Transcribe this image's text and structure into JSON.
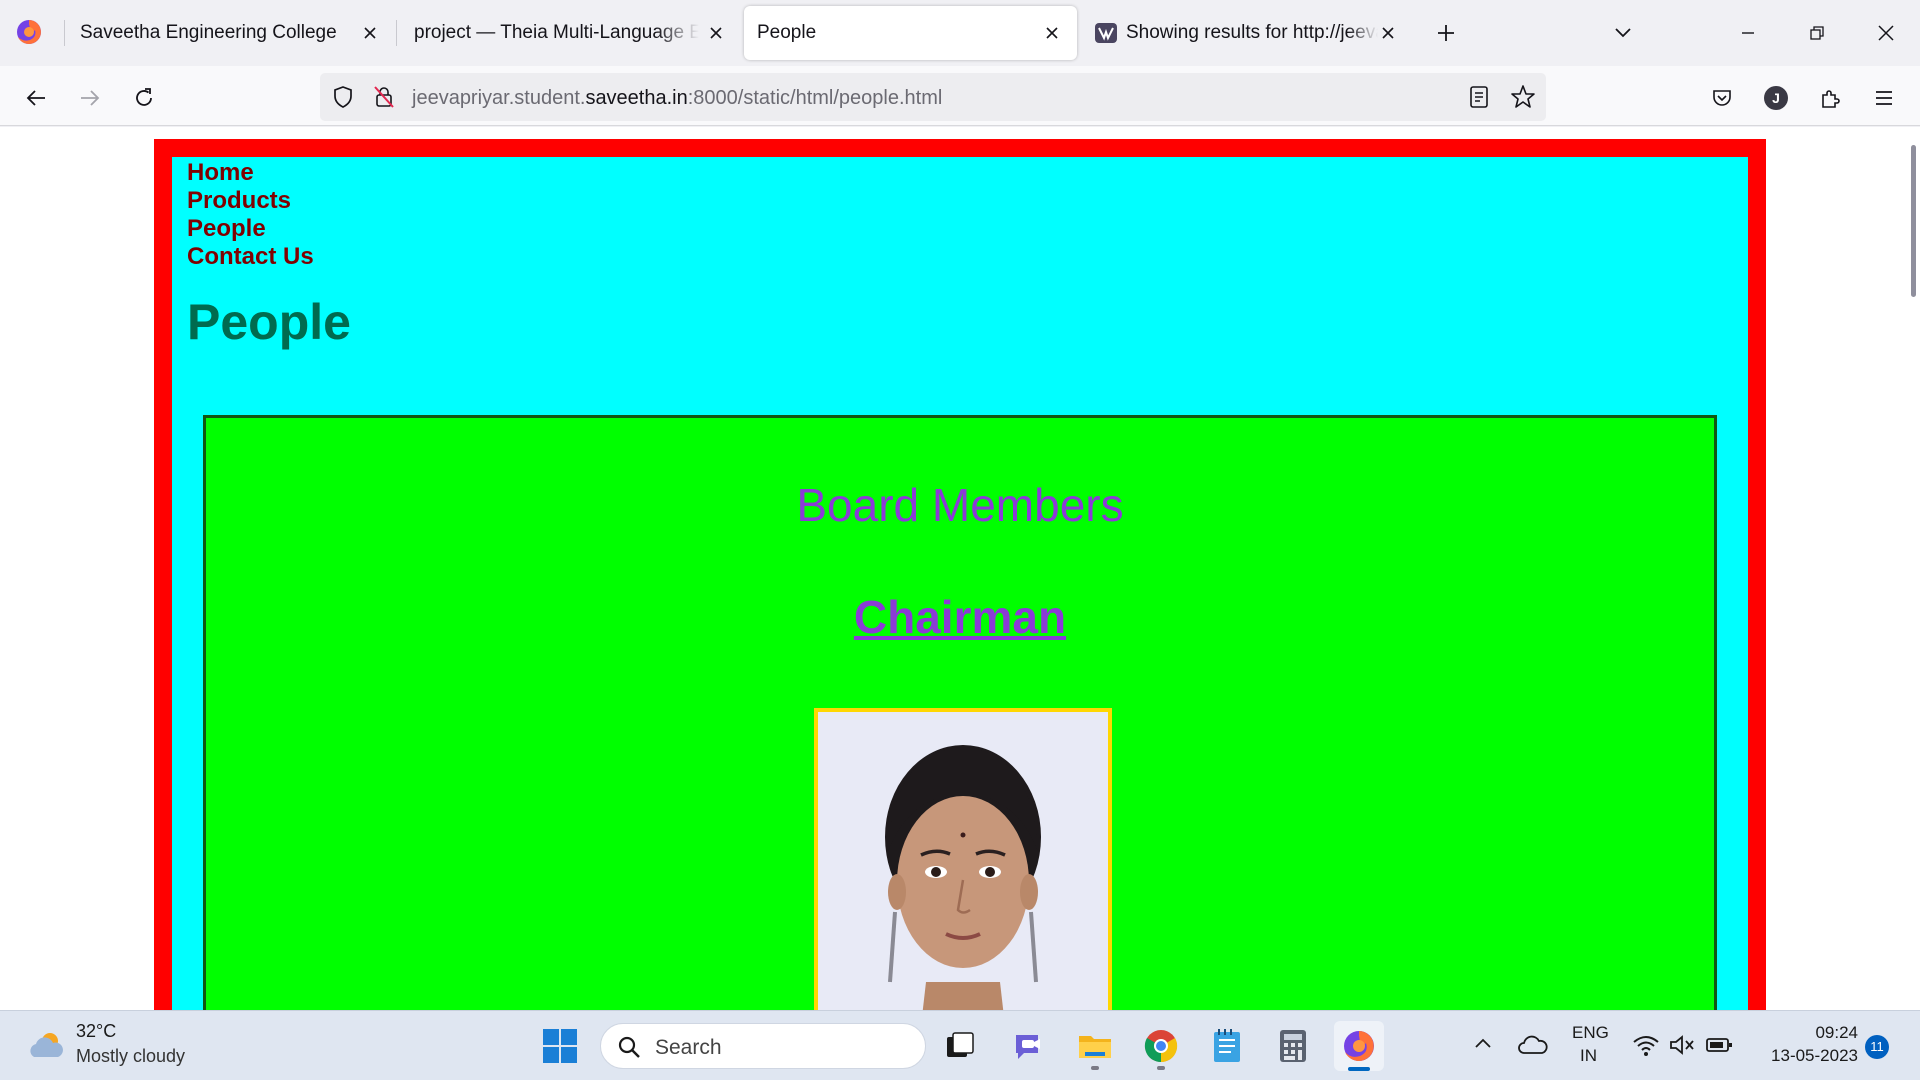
{
  "browser": {
    "tabs": [
      {
        "title": "Saveetha Engineering College"
      },
      {
        "title": "project — Theia Multi-Language Example"
      },
      {
        "title": "People"
      },
      {
        "title": "Showing results for http://jeevapriyar"
      }
    ],
    "url": {
      "prefix": "jeevapriyar.student.",
      "domain": "saveetha.in",
      "suffix": ":8000/static/html/people.html"
    },
    "account_initial": "J"
  },
  "page": {
    "nav": [
      "Home",
      "Products",
      "People",
      "Contact Us"
    ],
    "heading": "People",
    "section_title": "Board Members",
    "role_title": "Chairman"
  },
  "colors": {
    "outer_border": "#ff0000",
    "content_bg": "#00ffff",
    "section_bg": "#00ff00",
    "nav_link": "#800000",
    "heading": "#006b4f",
    "section_text": "#8b3bd6",
    "photo_border": "#ffd700"
  },
  "taskbar": {
    "weather_temp": "32°C",
    "weather_desc": "Mostly cloudy",
    "search_label": "Search",
    "lang_top": "ENG",
    "lang_bottom": "IN",
    "time": "09:24",
    "date": "13-05-2023",
    "notifications": "11"
  }
}
